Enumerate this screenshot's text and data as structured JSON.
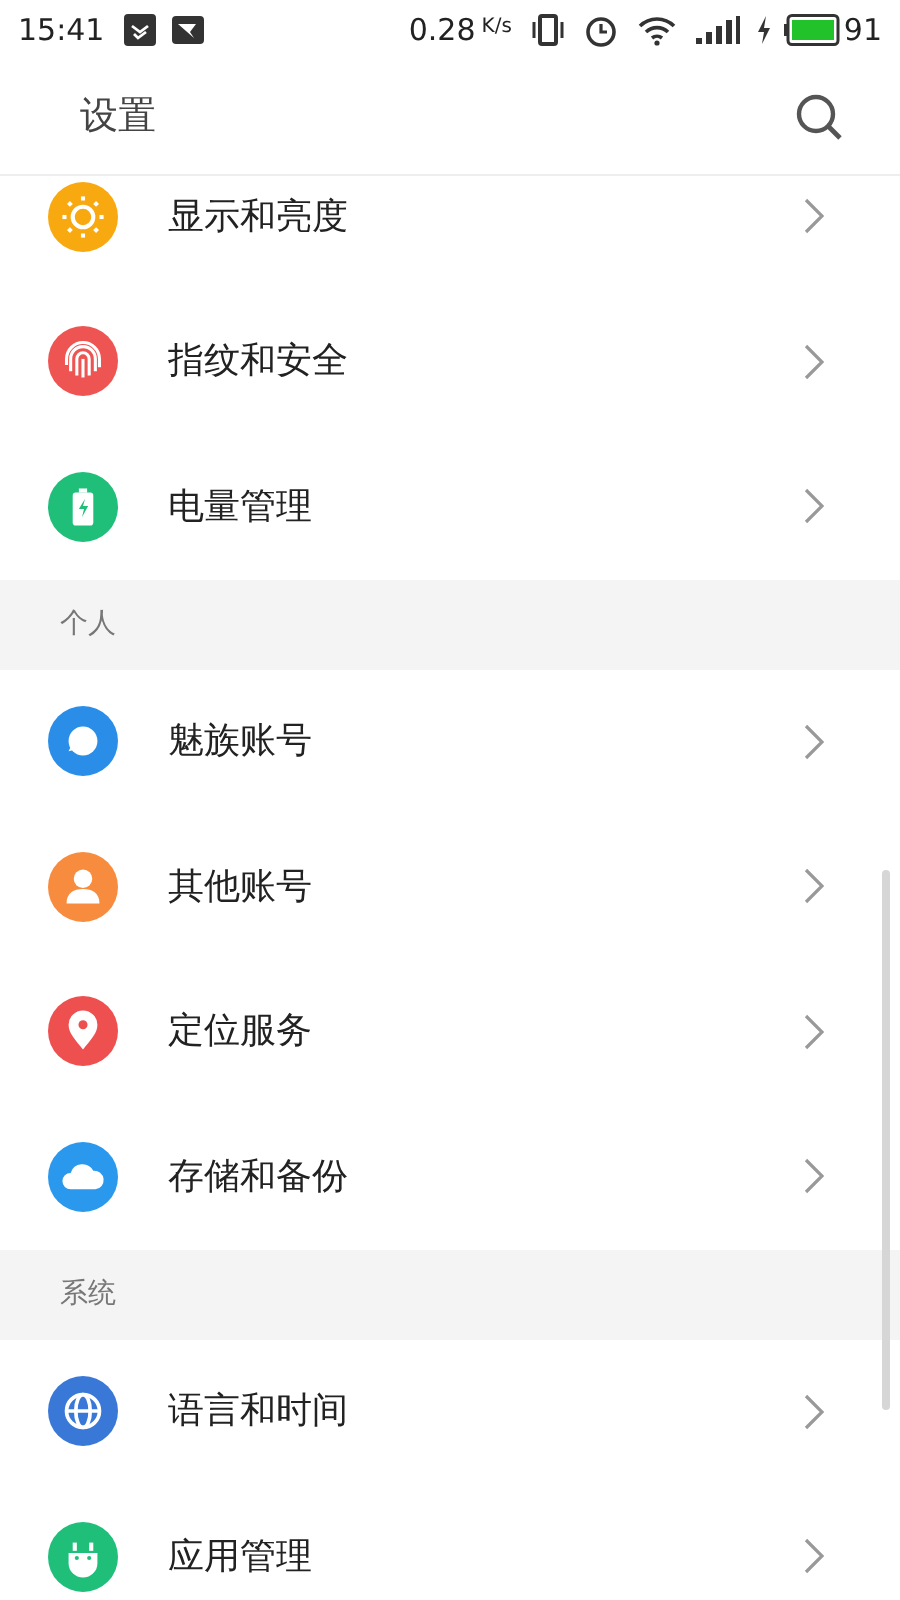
{
  "status_bar": {
    "time": "15:41",
    "speed": "0.28",
    "speed_unit": "K/s",
    "battery": "91"
  },
  "header": {
    "title": "设置"
  },
  "sections": [
    {
      "items": [
        {
          "label": "显示和亮度",
          "kind": "sun",
          "color": "#f7a90f"
        },
        {
          "label": "指纹和安全",
          "kind": "fingerprint",
          "color": "#ee5552"
        },
        {
          "label": "电量管理",
          "kind": "battery",
          "color": "#1fbf7a"
        }
      ]
    },
    {
      "title": "个人",
      "items": [
        {
          "label": "魅族账号",
          "kind": "bubble",
          "color": "#2a8ee8"
        },
        {
          "label": "其他账号",
          "kind": "person",
          "color": "#f88c3e"
        },
        {
          "label": "定位服务",
          "kind": "pin",
          "color": "#ee4f4f"
        },
        {
          "label": "存储和备份",
          "kind": "cloud",
          "color": "#2a98ec"
        }
      ]
    },
    {
      "title": "系统",
      "items": [
        {
          "label": "语言和时间",
          "kind": "globe",
          "color": "#3a78d8"
        },
        {
          "label": "应用管理",
          "kind": "robot",
          "color": "#1fbf7a"
        }
      ]
    }
  ]
}
